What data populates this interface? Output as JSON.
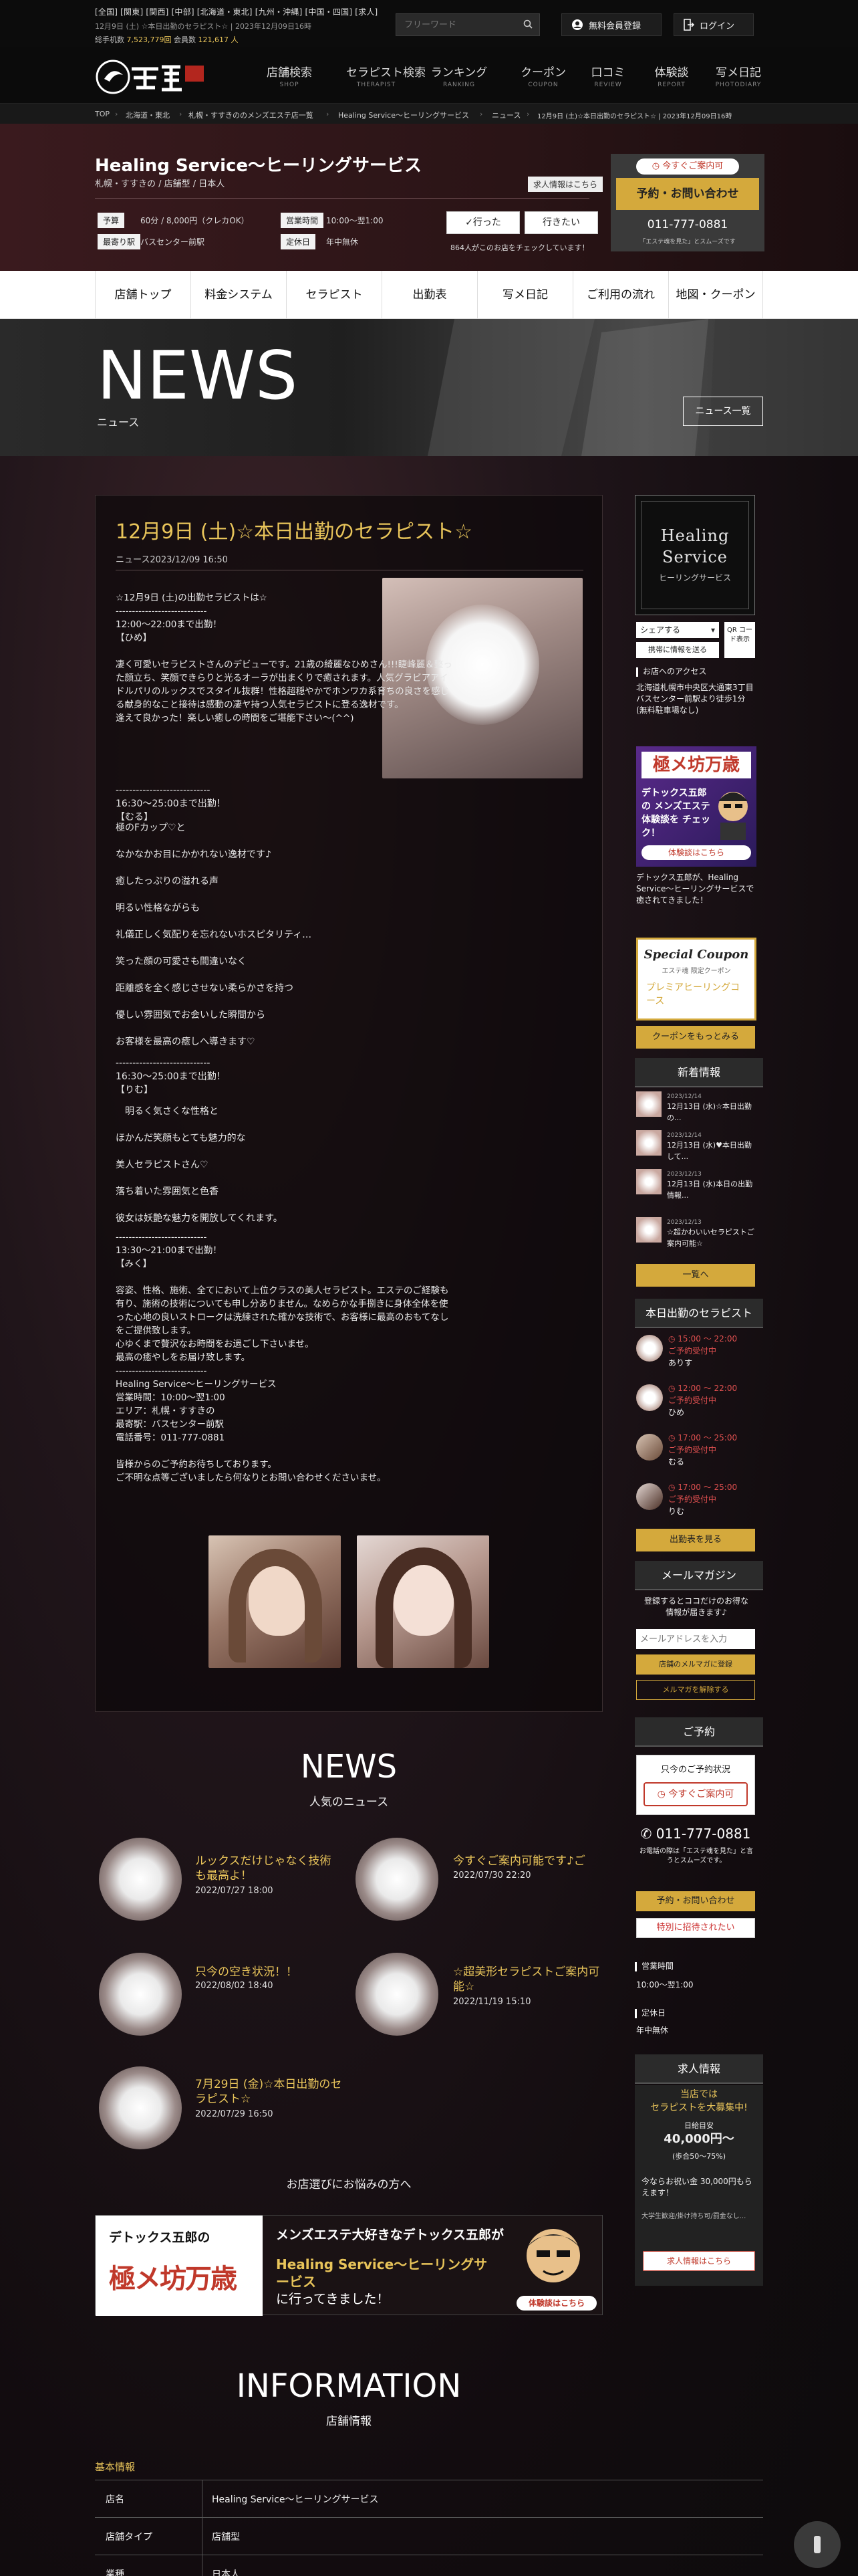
{
  "topbar": {
    "regions": "[全国] [関東] [関西] [中部] [北海道・東北] [九州・沖縄] [中国・四国] [求人]",
    "updated": "12月9日 (土) ☆本日出勤のセラピスト☆ | 2023年12月09日16時",
    "stats_label_1": "総手机数",
    "stats_value_1": "7,523,779回",
    "stats_label_2": "会員数",
    "stats_value_2": "121,617 人",
    "search_placeholder": "フリーワード",
    "register": "無料会員登録",
    "login": "ログイン"
  },
  "nav": [
    {
      "jp": "店舗検索",
      "en": "SHOP"
    },
    {
      "jp": "セラピスト検索",
      "en": "THERAPIST"
    },
    {
      "jp": "ランキング",
      "en": "RANKING"
    },
    {
      "jp": "クーポン",
      "en": "COUPON"
    },
    {
      "jp": "口コミ",
      "en": "REVIEW"
    },
    {
      "jp": "体験談",
      "en": "REPORT"
    },
    {
      "jp": "写メ日記",
      "en": "PHOTODIARY"
    }
  ],
  "breadcrumb": [
    "TOP",
    "北海道・東北",
    "札幌・すすきののメンズエステ店一覧",
    "Healing Service〜ヒーリングサービス",
    "ニュース",
    "12月9日 (土)☆本日出勤のセラピスト☆ | 2023年12月09日16時"
  ],
  "shop": {
    "name": "Healing Service〜ヒーリングサービス",
    "sub": "札幌・すすきの / 店舗型 / 日本人",
    "recruit": "求人情報はこちら",
    "budget_label": "予算",
    "budget": "60分 / 8,000円（クレカOK）",
    "hours_label": "営業時間",
    "hours": "10:00〜翌1:00",
    "station_label": "最寄り駅",
    "station": "バスセンター前駅",
    "holiday_label": "定休日",
    "holiday": "年中無休",
    "went": "行った",
    "want": "行きたい",
    "checked": "864人がこのお店をチェックしています！",
    "now_badge": "今すぐご案内可",
    "reserve": "予約・お問い合わせ",
    "phone": "011-777-0881",
    "phone_note": "「エステ魂を見た」とスムーズです"
  },
  "tabs": [
    "店舗トップ",
    "料金システム",
    "セラピスト",
    "出勤表",
    "写メ日記",
    "ご利用の流れ",
    "地図・クーポン"
  ],
  "hero": {
    "title": "NEWS",
    "subtitle": "ニュース",
    "list_button": "ニュース一覧"
  },
  "article": {
    "title": "12月9日 (土)☆本日出勤のセラピスト☆",
    "date": "ニュース2023/12/09 16:50",
    "block1": "☆12月9日 (土)の出勤セラピストは☆\n----------------------------\n12:00〜22:00まで出勤！\n【ひめ】\n\n凄く可愛いセラピストさんのデビューです。21歳の綺麗なひめさん!!!睫峰麗＆整った顔立ち、笑顔できらりと光るオーラが出まくりで癒されます。人気グラビアアイドルパリのルックスでスタイル抜群！性格超穏やかでホンワカ系育ちの良さを感じる献身的なこと接待は感動の凄ヤ持つ人気セラピストに登る逸材です。\n逢えて良かった！楽しい癒しの時間をご堪能下さい〜(^^)",
    "block2": "----------------------------\n16:30〜25:00まで出勤！\n【むる】",
    "lines_muru": [
      "極のFカップ♡と",
      "なかなかお目にかかれない逸材です♪",
      "癒したっぷりの溢れる声",
      "明るい性格ながらも",
      "礼儀正しく気配りを忘れないホスピタリティ…",
      "笑った顔の可愛さも間違いなく",
      "距離感を全く感じさせない柔らかさを持つ",
      "優しい雰囲気でお会いした瞬間から",
      "お客様を最高の癒しへ導きます♡"
    ],
    "block3": "----------------------------\n16:30〜25:00まで出勤！\n【りむ】",
    "lines_rimu": [
      "　明るく気さくな性格と",
      "ほかんだ笑顔もとても魅力的な",
      "美人セラピストさん♡",
      "落ち着いた雰囲気と色香",
      "彼女は妖艶な魅力を開放してくれます。"
    ],
    "block4": "----------------------------\n13:30〜21:00まで出勤！\n【みく】\n\n容姿、性格、施術、全てにおいて上位クラスの美人セラピスト。エステのご経験も有り、施術の技術についても申し分ありません。なめらかな手捌きに身体全体を使った心地の良いストロークは洗練された確かな技術で、お客様に最高のおもてなしをご提供致します。\n心ゆくまで贅沢なお時間をお過ごし下さいませ。\n最高の癒やしをお届け致します。\n----------------------------\nHealing Service〜ヒーリングサービス\n営業時間：10:00〜翌1:00\nエリア：札幌・すすきの\n最寄駅：バスセンター前駅\n電話番号：011-777-0881\n\n皆様からのご予約お待ちしております。\nご不明な点等ございましたら何なりとお問い合わせくださいませ。"
  },
  "popular": {
    "title": "NEWS",
    "subtitle": "人気のニュース",
    "items": [
      {
        "title": "ルックスだけじゃなく技術も最高よ！",
        "date": "2022/07/27 18:00"
      },
      {
        "title": "今すぐご案内可能です♪ご",
        "date": "2022/07/30 22:20"
      },
      {
        "title": "只今の空き状況！！",
        "date": "2022/08/02 18:40"
      },
      {
        "title": "☆超美形セラピストご案内可能☆",
        "date": "2022/11/19 15:10"
      },
      {
        "title": "7月29日 (金)☆本日出勤のセラピスト☆",
        "date": "2022/07/29 16:50"
      }
    ],
    "worry": "お店選びにお悩みの方へ"
  },
  "banner": {
    "left_small": "デトックス五郎の",
    "left_big": "極メ坊万歳",
    "headline": "メンズエステ大好きなデトックス五郎が",
    "shop": "Healing Service〜ヒーリングサービス",
    "tail": "に行ってきました！",
    "badge": "体験談はこちら"
  },
  "information": {
    "title": "INFORMATION",
    "subtitle": "店舗情報",
    "basic": "基本情報",
    "rows": [
      {
        "k": "店名",
        "v": "Healing Service〜ヒーリングサービス"
      },
      {
        "k": "店舗タイプ",
        "v": "店舗型"
      },
      {
        "k": "業種",
        "v": "日本人"
      }
    ]
  },
  "sidebar": {
    "logo_line1": "Healing",
    "logo_line2": "Service",
    "logo_line3": "ヒーリングサービス",
    "share": "シェアする",
    "qr": "QR コード表示",
    "mobile": "携帯に情報を送る",
    "access_label": "お店へのアクセス",
    "access": "北海道札幌市中央区大通東3丁目\nバスセンター前駅より徒歩1分(無料駐車場なし)",
    "report_title": "極メ坊万歳",
    "report_sub": "デトックス五郎の メンズエステ 体験談を チェック！",
    "report_btn": "体験談はこちら",
    "report_note": "デトックス五郎が、Healing Service〜ヒーリングサービスで癒されてきました！",
    "coupon_title": "Special Coupon",
    "coupon_sub": "エステ魂 限定クーポン",
    "coupon_name": "プレミアヒーリングコース",
    "coupon_btn": "クーポンをもっとみる",
    "news_head": "新着情報",
    "news": [
      {
        "date": "2023/12/14",
        "text": "12月13日 (水)☆本日出勤の..."
      },
      {
        "date": "2023/12/14",
        "text": "12月13日 (水)♥本日出勤して..."
      },
      {
        "date": "2023/12/13",
        "text": "12月13日 (水)本日の出勤情報..."
      },
      {
        "date": "2023/12/13",
        "text": "☆超かわいいセラピストご案内可能☆"
      }
    ],
    "news_btn": "一覧へ",
    "today_head": "本日出勤のセラピスト",
    "therapists": [
      {
        "time": "15:00 〜 22:00",
        "status": "ご予約受付中",
        "name": "ありす"
      },
      {
        "time": "12:00 〜 22:00",
        "status": "ご予約受付中",
        "name": "ひめ"
      },
      {
        "time": "17:00 〜 25:00",
        "status": "ご予約受付中",
        "name": "むる"
      },
      {
        "time": "17:00 〜 25:00",
        "status": "ご予約受付中",
        "name": "りむ"
      }
    ],
    "today_btn": "出勤表を見る",
    "mail_head": "メールマガジン",
    "mail_text": "登録するとココだけのお得な情報が届きます♪",
    "mail_placeholder": "メールアドレスを入力",
    "mail_reg": "店舗のメルマガに登録",
    "mail_unreg": "メルマガを解除する",
    "rsv_head": "ご予約",
    "rsv_status_label": "只今のご予約状況",
    "rsv_status": "今すぐご案内可",
    "rsv_phone": "011-777-0881",
    "rsv_note": "お電話の際は「エステ魂を見た」と言うとスムーズです。",
    "rsv_btn": "予約・お問い合わせ",
    "rsv_btn2": "特別に招待されたい",
    "hours_label": "営業時間",
    "hours": "10:00〜翌1:00",
    "holiday_label": "定休日",
    "holiday": "年中無休",
    "job_head": "求人情報",
    "job_text1": "当店では",
    "job_text2": "セラピストを大募集中!",
    "job_salary_label": "日給目安",
    "job_salary": "40,000円〜",
    "job_salary_note": "(歩合50〜75%)",
    "job_bonus": "今ならお祝い金 30,000円もらえます！",
    "job_note": "大学生歓迎/掛け持ち可/罰金なし...",
    "job_btn": "求人情報はこちら"
  }
}
